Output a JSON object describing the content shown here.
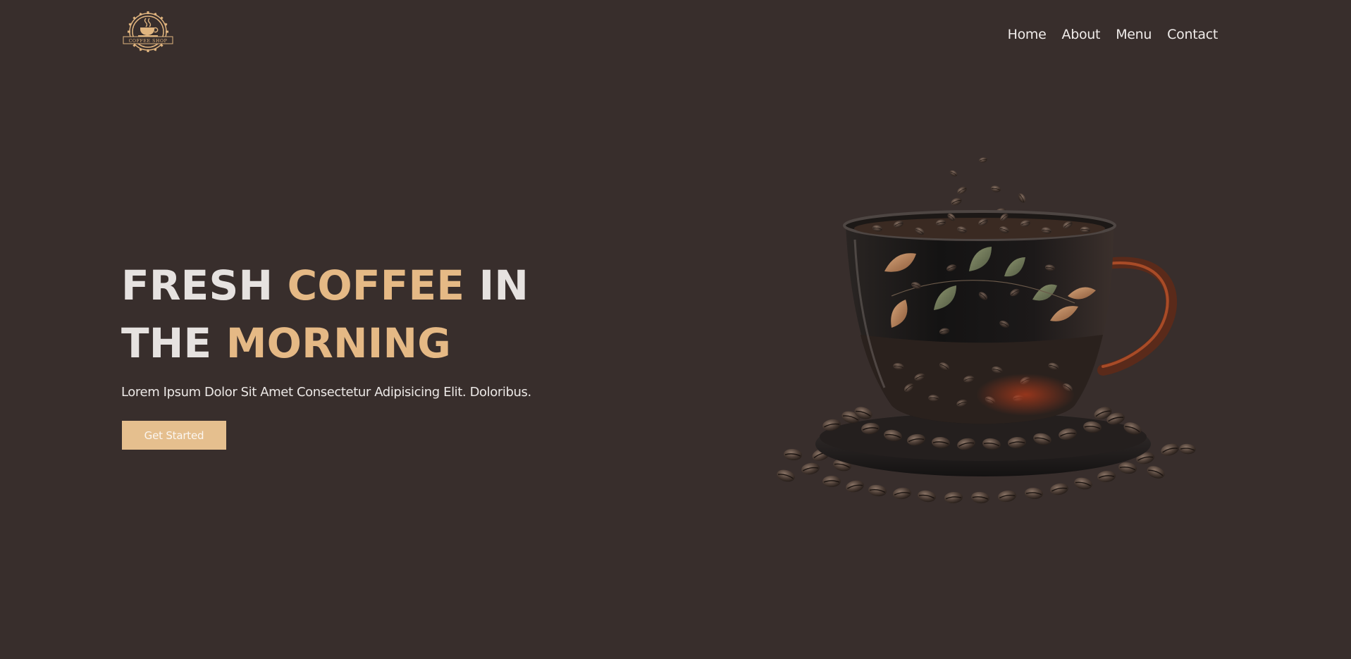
{
  "brand": {
    "logo_text": "COFFEE SHOP"
  },
  "nav": {
    "items": [
      "Home",
      "About",
      "Menu",
      "Contact"
    ]
  },
  "hero": {
    "title_part1": "FRESH ",
    "title_accent1": "COFFEE",
    "title_part2": " IN THE ",
    "title_accent2": "MORNING",
    "subtitle": "Lorem Ipsum Dolor Sit Amet Consectetur Adipisicing Elit. Doloribus.",
    "cta_label": "Get Started",
    "image_icon": "coffee-cup-icon"
  },
  "colors": {
    "background": "#382e2c",
    "accent": "#e5b985",
    "button": "#e5bf8e",
    "text": "#e6e2e0"
  }
}
